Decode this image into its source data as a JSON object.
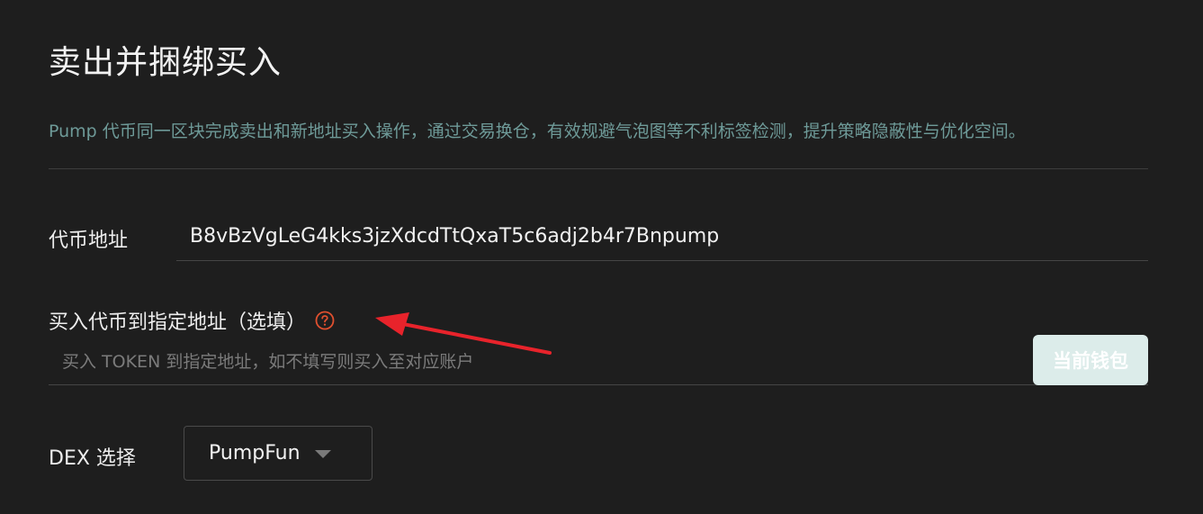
{
  "page": {
    "title": "卖出并捆绑买入",
    "description": "Pump 代币同一区块完成卖出和新地址买入操作，通过交易换仓，有效规避气泡图等不利标签检测，提升策略隐蔽性与优化空间。"
  },
  "token_field": {
    "label": "代币地址",
    "value": "B8vBzVgLeG4kks3jzXdcdTtQxaT5c6adj2b4r7Bnpump"
  },
  "buy_address_field": {
    "label": "买入代币到指定地址（选填）",
    "placeholder": "买入 TOKEN 到指定地址，如不填写则买入至对应账户",
    "help_icon": "question-circle-icon",
    "wallet_button_label": "当前钱包"
  },
  "dex_field": {
    "label": "DEX 选择",
    "selected": "PumpFun"
  },
  "colors": {
    "background": "#1e1e1e",
    "description": "#6e9a98",
    "button": "#dcecea",
    "annotation_arrow": "#e8232b"
  }
}
